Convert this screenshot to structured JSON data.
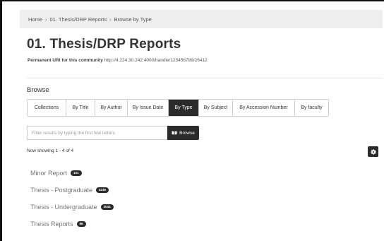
{
  "breadcrumb": {
    "items": [
      "Home",
      "01. Thesis/DRP Reports",
      "Browse by Type"
    ],
    "separator": "›"
  },
  "page": {
    "title": "01. Thesis/DRP Reports",
    "uri_label": "Permanent URI for this community",
    "uri_value": "http://4.224.30.242:4000/handle/123456789/26412"
  },
  "browse": {
    "heading": "Browse",
    "tabs": [
      {
        "label": "Collections",
        "active": false
      },
      {
        "label": "By Title",
        "active": false
      },
      {
        "label": "By Author",
        "active": false
      },
      {
        "label": "By Issue Date",
        "active": false
      },
      {
        "label": "By Type",
        "active": true
      },
      {
        "label": "By Subject",
        "active": false
      },
      {
        "label": "By Accession Number",
        "active": false
      },
      {
        "label": "By faculty",
        "active": false
      }
    ],
    "filter_placeholder": "Filter results by typing the first few letters",
    "browse_button_label": "Browse",
    "browse_button_icon": "book-icon",
    "settings_icon": "gear-icon"
  },
  "results": {
    "showing_text": "Now showing 1 - 4 of 4",
    "items": [
      {
        "label": "Minor Report",
        "count": "101"
      },
      {
        "label": "Thesis - Postgraduate",
        "count": "5249"
      },
      {
        "label": "Thesis - Undergraduate",
        "count": "3044"
      },
      {
        "label": "Thesis Reports",
        "count": "86"
      }
    ]
  },
  "colors": {
    "active_dark": "#2b2b2b",
    "breadcrumb_bg": "#eeeeee",
    "muted_text": "#777777"
  }
}
